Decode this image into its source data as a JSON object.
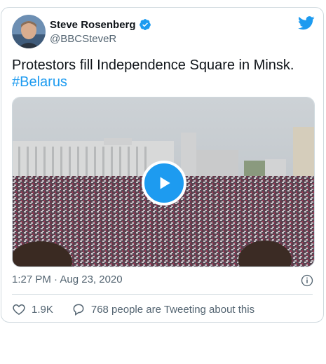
{
  "tweet": {
    "author_name": "Steve Rosenberg",
    "author_handle": "@BBCSteveR",
    "text": "Protestors fill Independence Square in Minsk.",
    "hashtag": "#Belarus",
    "timestamp": "1:27 PM · Aug 23, 2020",
    "likes": "1.9K",
    "replies_text": "768 people are Tweeting about this"
  },
  "icons": {
    "verified": "verified-badge-icon",
    "bird": "twitter-bird-icon",
    "play": "play-icon",
    "info": "info-icon",
    "heart": "heart-icon",
    "reply": "speech-bubble-icon"
  },
  "colors": {
    "accent": "#1d9bf0",
    "text": "#0f1419",
    "muted": "#536471",
    "border": "#cfd9de"
  }
}
